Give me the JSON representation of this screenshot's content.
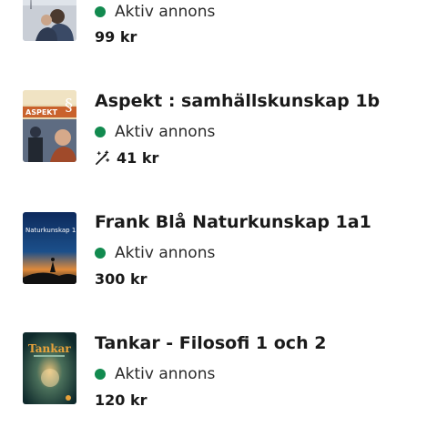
{
  "listings": [
    {
      "title": "",
      "status": "Aktiv annons",
      "price": "99 kr",
      "status_color": "#128a4f"
    },
    {
      "title": "Aspekt : samhällskunskap 1b",
      "status": "Aktiv annons",
      "price": "41 kr",
      "status_color": "#128a4f",
      "price_icon": "magic-wand-icon"
    },
    {
      "title": "Frank Blå Naturkunskap 1a1",
      "status": "Aktiv annons",
      "price": "300 kr",
      "status_color": "#128a4f"
    },
    {
      "title": "Tankar - Filosofi 1 och 2",
      "status": "Aktiv annons",
      "price": "120 kr",
      "status_color": "#128a4f"
    }
  ],
  "covers": {
    "aspekt_title": "ASPEKT",
    "naturkunskap_title": "Naturkunskap 1",
    "tankar_title": "Tankar"
  }
}
